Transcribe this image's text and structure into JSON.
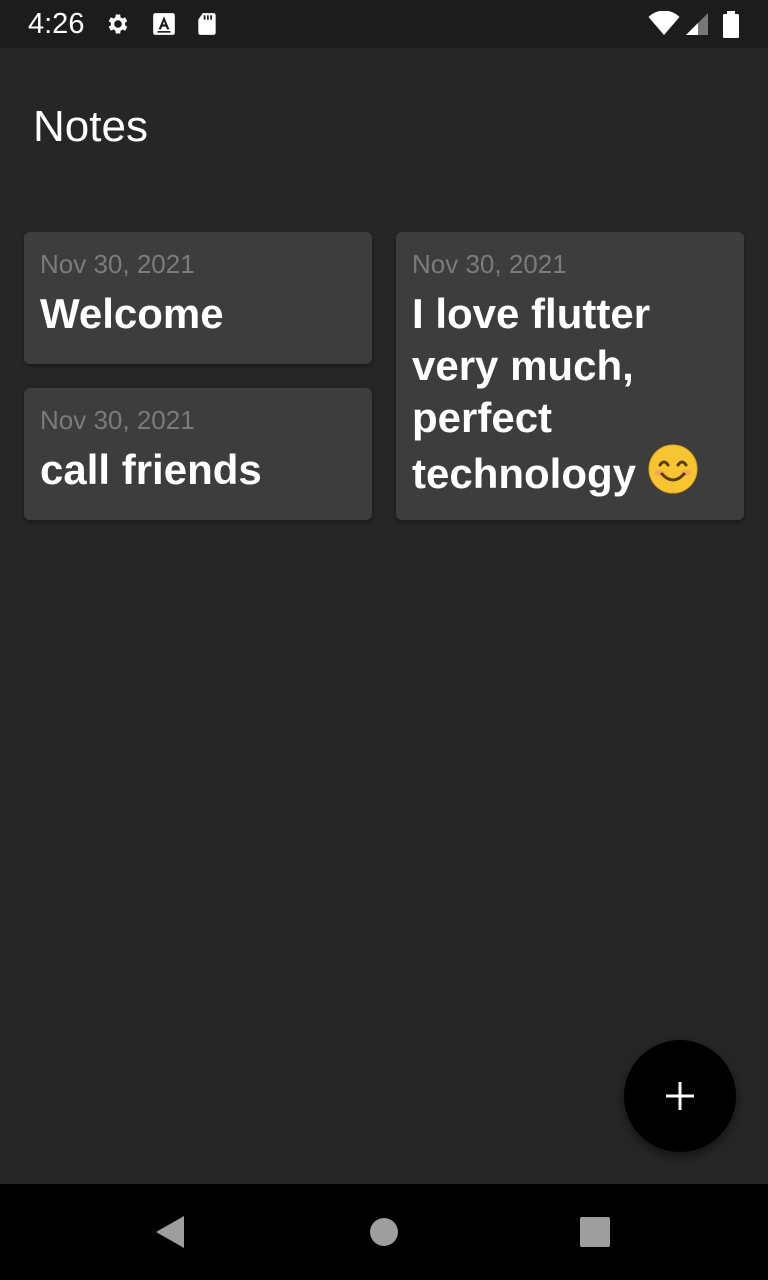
{
  "status_bar": {
    "time": "4:26",
    "left_icons": [
      "gear-icon",
      "accessibility-a-icon",
      "sd-card-icon"
    ],
    "right_icons": [
      "wifi-icon",
      "cell-signal-icon",
      "battery-icon"
    ]
  },
  "app_bar": {
    "title": "Notes"
  },
  "notes": [
    {
      "date": "Nov 30, 2021",
      "title": "Welcome"
    },
    {
      "date": "Nov 30, 2021",
      "title": "call friends"
    },
    {
      "date": "Nov 30, 2021",
      "title": "I love flutter very much, perfect technology",
      "emoji": "smiling-face-icon"
    }
  ],
  "fab": {
    "icon": "plus-icon"
  },
  "nav_bar": {
    "buttons": [
      "back-icon",
      "home-icon",
      "recents-icon"
    ]
  },
  "colors": {
    "background": "#262626",
    "card": "#3d3d3d",
    "date_text": "#7b7b7b",
    "title_text": "#ffffff",
    "fab": "#000000",
    "status_bar": "#1c1c1c",
    "nav_bar": "#000000"
  }
}
